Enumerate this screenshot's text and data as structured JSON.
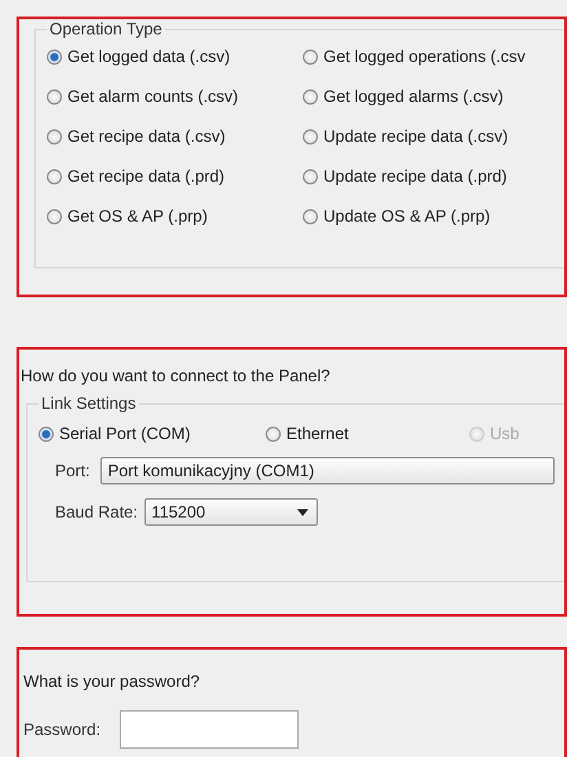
{
  "operation_type": {
    "title": "Operation Type",
    "options": [
      {
        "label": "Get logged data (.csv)",
        "selected": true
      },
      {
        "label": "Get logged operations (.csv",
        "selected": false
      },
      {
        "label": "Get alarm counts (.csv)",
        "selected": false
      },
      {
        "label": "Get logged alarms (.csv)",
        "selected": false
      },
      {
        "label": "Get recipe data (.csv)",
        "selected": false
      },
      {
        "label": "Update recipe data (.csv)",
        "selected": false
      },
      {
        "label": "Get recipe data (.prd)",
        "selected": false
      },
      {
        "label": "Update recipe data (.prd)",
        "selected": false
      },
      {
        "label": "Get OS & AP (.prp)",
        "selected": false
      },
      {
        "label": "Update OS & AP (.prp)",
        "selected": false
      }
    ]
  },
  "connection": {
    "question": "How do you want to connect to the Panel?",
    "group_title": "Link Settings",
    "links": [
      {
        "label": "Serial Port (COM)",
        "selected": true,
        "disabled": false
      },
      {
        "label": "Ethernet",
        "selected": false,
        "disabled": false
      },
      {
        "label": "Usb",
        "selected": false,
        "disabled": true
      }
    ],
    "port": {
      "label": "Port:",
      "value": "Port komunikacyjny (COM1)"
    },
    "baud_rate": {
      "label": "Baud Rate:",
      "value": "115200"
    }
  },
  "password": {
    "question": "What is your password?",
    "label": "Password:"
  }
}
